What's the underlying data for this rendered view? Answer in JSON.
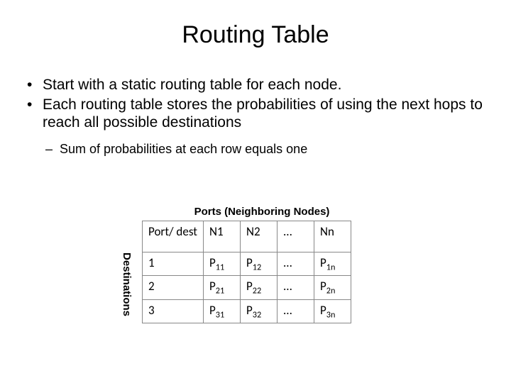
{
  "title": "Routing Table",
  "bullets": [
    "Start with a static routing table for each node.",
    "Each routing table stores the probabilities of using the next hops to reach all possible destinations"
  ],
  "sub_bullets": [
    "Sum of probabilities at each row equals one"
  ],
  "captions": {
    "top": "Ports (Neighboring  Nodes)",
    "left": "Destinations"
  },
  "table": {
    "corner": "Port/ dest",
    "col_headers": [
      "N1",
      "N2",
      "...",
      "Nn"
    ],
    "rows": [
      {
        "dest": "1",
        "cells": [
          {
            "base": "P",
            "sub": "11"
          },
          {
            "base": "P",
            "sub": "12"
          },
          {
            "base": "...",
            "sub": ""
          },
          {
            "base": "P",
            "sub": "1n"
          }
        ]
      },
      {
        "dest": "2",
        "cells": [
          {
            "base": "P",
            "sub": "21"
          },
          {
            "base": "P",
            "sub": "22"
          },
          {
            "base": "...",
            "sub": ""
          },
          {
            "base": "P",
            "sub": "2n"
          }
        ]
      },
      {
        "dest": "3",
        "cells": [
          {
            "base": "P",
            "sub": "31"
          },
          {
            "base": "P",
            "sub": "32"
          },
          {
            "base": "...",
            "sub": ""
          },
          {
            "base": "P",
            "sub": "3n"
          }
        ]
      }
    ]
  }
}
